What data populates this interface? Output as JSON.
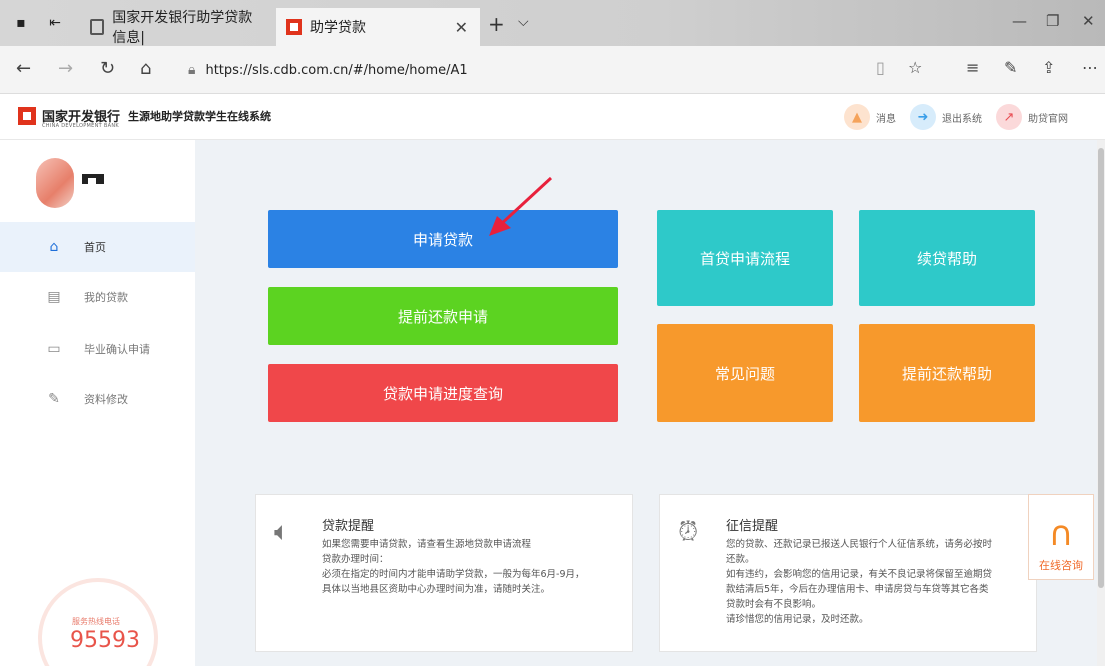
{
  "browser": {
    "tabs": [
      {
        "label": "国家开发银行助学贷款信息|",
        "active": false
      },
      {
        "label": "助学贷款",
        "active": true
      }
    ],
    "url": "https://sls.cdb.com.cn/#/home/home/A1"
  },
  "header": {
    "bank_name": "国家开发银行",
    "bank_name_en": "CHINA DEVELOPMENT BANK",
    "system_name": "生源地助学贷款学生在线系统",
    "links": [
      {
        "label": "消息",
        "icon": "bell-icon",
        "color": "#f5a35b"
      },
      {
        "label": "退出系统",
        "icon": "logout-icon",
        "color": "#3a9ee8"
      },
      {
        "label": "助贷官网",
        "icon": "external-link-icon",
        "color": "#e84c52"
      }
    ]
  },
  "sidebar": {
    "items": [
      {
        "label": "首页",
        "icon": "home-icon",
        "active": true
      },
      {
        "label": "我的贷款",
        "icon": "document-icon",
        "active": false
      },
      {
        "label": "毕业确认申请",
        "icon": "monitor-icon",
        "active": false
      },
      {
        "label": "资料修改",
        "icon": "edit-icon",
        "active": false
      }
    ],
    "hotline_label": "服务热线电话",
    "hotline_number": "95593"
  },
  "main": {
    "actions": {
      "apply_loan": "申请贷款",
      "early_repay_apply": "提前还款申请",
      "progress_query": "贷款申请进度查询",
      "first_loan_process": "首贷申请流程",
      "renewal_help": "续贷帮助",
      "faq": "常见问题",
      "early_repay_help": "提前还款帮助"
    },
    "loan_notice": {
      "title": "贷款提醒",
      "lines": [
        "如果您需要申请贷款，请查看生源地贷款申请流程",
        "贷款办理时间：",
        "必须在指定的时间内才能申请助学贷款，一般为每年6月-9月，",
        "具体以当地县区资助中心办理时间为准，请随时关注。"
      ]
    },
    "credit_notice": {
      "title": "征信提醒",
      "lines": [
        "您的贷款、还款记录已报送人民银行个人征信系统，请务必按时",
        "还款。",
        "如有违约，会影响您的信用记录，有关不良记录将保留至逾期贷",
        "款结清后5年，今后在办理信用卡、申请房贷与车贷等其它各类",
        "贷款时会有不良影响。",
        "请珍惜您的信用记录，及时还款。"
      ]
    },
    "consult_label": "在线咨询"
  }
}
